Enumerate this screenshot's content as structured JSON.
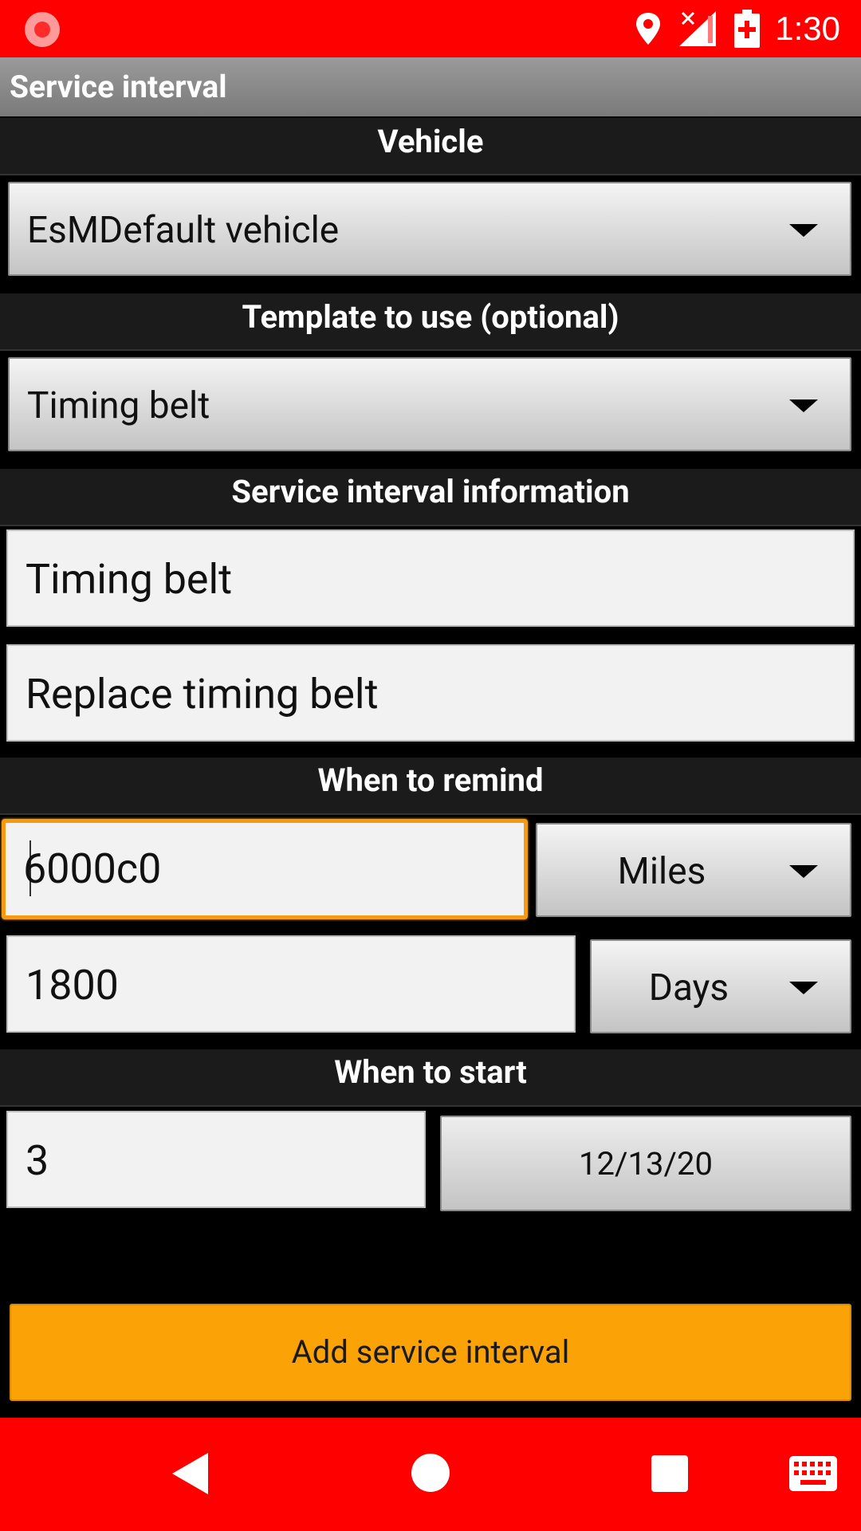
{
  "status_bar": {
    "time": "1:30",
    "icons": [
      "screen-record-icon",
      "location-icon",
      "signal-icon",
      "battery-charging-icon"
    ]
  },
  "app_bar": {
    "title": "Service interval"
  },
  "sections": {
    "vehicle": "Vehicle",
    "template": "Template to use (optional)",
    "info": "Service interval information",
    "remind": "When to remind",
    "start": "When to start"
  },
  "vehicle_spinner": {
    "selected": "EsMDefault vehicle"
  },
  "template_spinner": {
    "selected": "Timing belt"
  },
  "info": {
    "name_value": "Timing belt",
    "description_value": "Replace timing belt"
  },
  "remind": {
    "distance_value": "6000c0",
    "distance_unit": "Miles",
    "time_value": "1800",
    "time_unit": "Days"
  },
  "start": {
    "value": "3",
    "date": "12/13/20"
  },
  "add_button": {
    "label": "Add service interval"
  },
  "colors": {
    "status_bar": "#ff0000",
    "nav_bar": "#ff0000",
    "accent": "#fba306",
    "focus": "#f59a12"
  }
}
